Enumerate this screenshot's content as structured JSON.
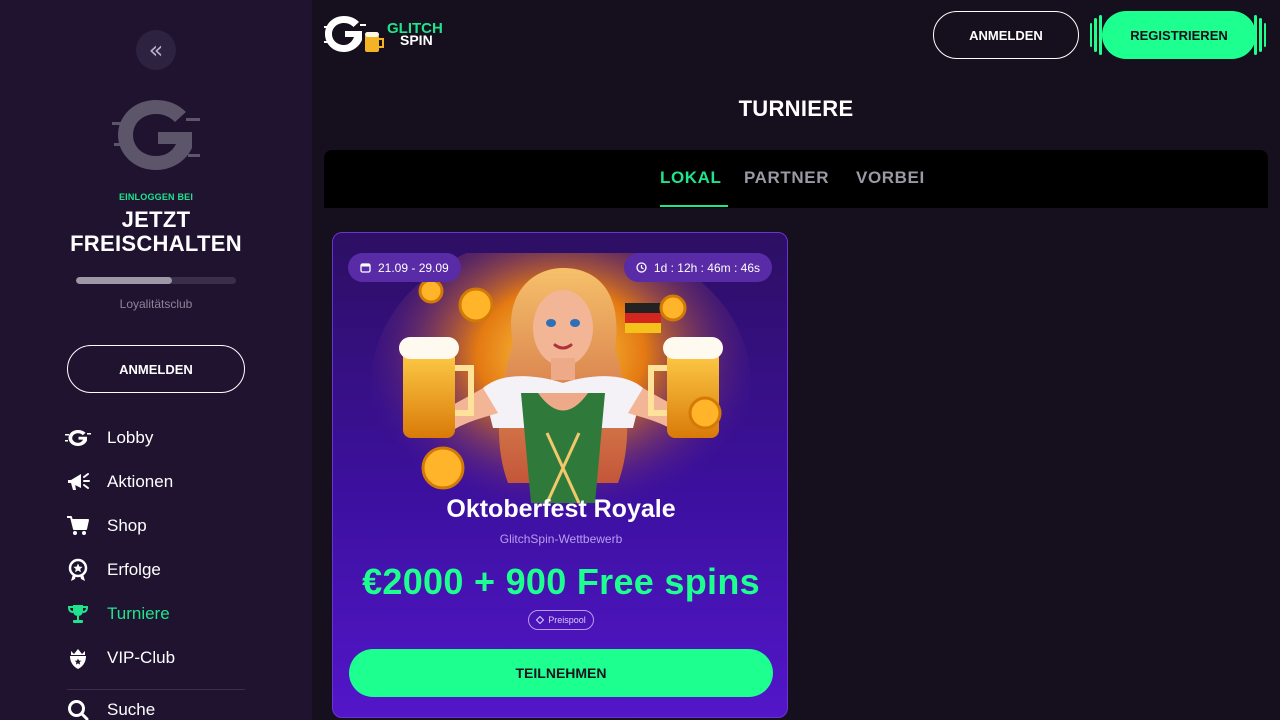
{
  "header": {
    "logo_line1": "GLITCH",
    "logo_line2": "SPIN",
    "login_label": "ANMELDEN",
    "register_label": "REGISTRIEREN"
  },
  "sidebar": {
    "collapse_icon": "double-chevron-left-icon",
    "login_prompt": "EINLOGGEN BEI",
    "unlock_line1": "JETZT",
    "unlock_line2": "FREISCHALTEN",
    "loyalty_label": "Loyalitätsclub",
    "loyalty_progress": 0.6,
    "login_label": "ANMELDEN",
    "items": [
      {
        "label": "Lobby",
        "icon": "lobby-icon"
      },
      {
        "label": "Aktionen",
        "icon": "megaphone-icon"
      },
      {
        "label": "Shop",
        "icon": "cart-icon"
      },
      {
        "label": "Erfolge",
        "icon": "achievement-icon"
      },
      {
        "label": "Turniere",
        "icon": "trophy-icon",
        "active": true
      },
      {
        "label": "VIP-Club",
        "icon": "vip-icon"
      },
      {
        "label": "Suche",
        "icon": "search-icon"
      }
    ]
  },
  "page": {
    "title": "TURNIERE",
    "tabs": [
      {
        "label": "LOKAL",
        "active": true
      },
      {
        "label": "PARTNER",
        "active": false
      },
      {
        "label": "VORBEI",
        "active": false
      }
    ]
  },
  "tournament": {
    "dates": "21.09 - 29.09",
    "timer": "1d : 12h : 46m : 46s",
    "name": "Oktoberfest Royale",
    "subtitle": "GlitchSpin-Wettbewerb",
    "prize": "€2000 + 900 Free spins",
    "prize_badge": "Preispool",
    "join_label": "TEILNEHMEN"
  },
  "colors": {
    "accent": "#1fe48b",
    "button_green": "#1dff8f",
    "sidebar_bg": "#1f1330",
    "page_bg": "#160f1d",
    "card_purple": "#4312b0"
  }
}
